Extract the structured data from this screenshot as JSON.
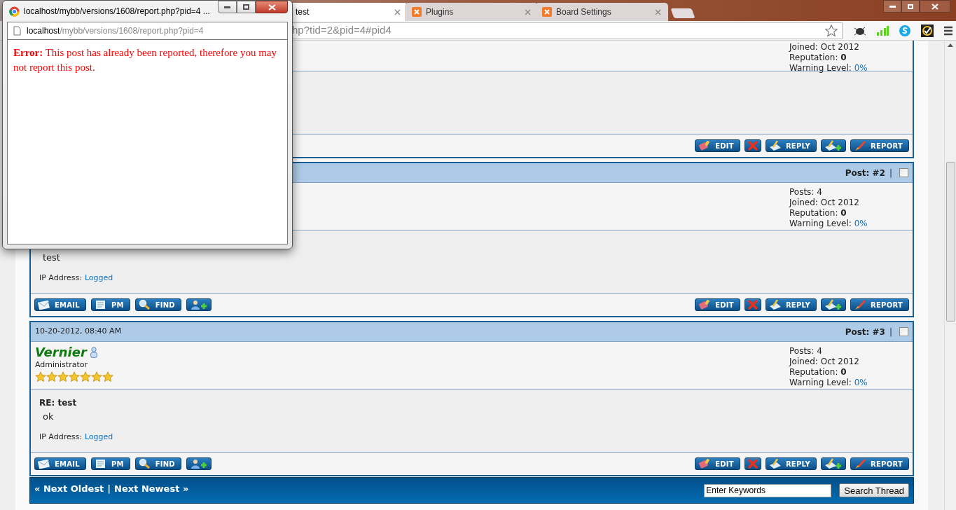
{
  "browser": {
    "tabs": [
      {
        "label": "test",
        "selected": true,
        "favicon": false
      },
      {
        "label": "Plugins",
        "selected": false,
        "favicon": true
      },
      {
        "label": "Board Settings",
        "selected": false,
        "favicon": true
      }
    ],
    "address": "hp?tid=2&pid=4#pid4"
  },
  "posts": [
    {
      "stats": [
        {
          "label": "Joined:",
          "value": "Oct 2012",
          "kind": "plain"
        },
        {
          "label": "Reputation:",
          "value": "0",
          "kind": "bold"
        },
        {
          "label": "Warning Level:",
          "value": "0%",
          "kind": "link"
        }
      ],
      "buttons_right": [
        {
          "kind": "edit",
          "label": "EDIT"
        },
        {
          "kind": "delete"
        },
        {
          "kind": "reply",
          "label": "REPLY"
        },
        {
          "kind": "quote"
        },
        {
          "kind": "report",
          "label": "REPORT"
        }
      ]
    },
    {
      "header": {
        "post_number": "Post: #2",
        "separator": "|",
        "checked": false
      },
      "stats": [
        {
          "label": "Posts:",
          "value": "4",
          "kind": "plain"
        },
        {
          "label": "Joined:",
          "value": "Oct 2012",
          "kind": "plain"
        },
        {
          "label": "Reputation:",
          "value": "0",
          "kind": "bold"
        },
        {
          "label": "Warning Level:",
          "value": "0%",
          "kind": "link"
        }
      ],
      "body": {
        "text": "test",
        "ip_label": "IP Address:",
        "ip_link": "Logged"
      },
      "buttons_left": [
        {
          "kind": "email",
          "label": "EMAIL"
        },
        {
          "kind": "pm",
          "label": "PM"
        },
        {
          "kind": "find",
          "label": "FIND"
        },
        {
          "kind": "adduser"
        }
      ],
      "buttons_right": [
        {
          "kind": "edit",
          "label": "EDIT"
        },
        {
          "kind": "delete"
        },
        {
          "kind": "reply",
          "label": "REPLY"
        },
        {
          "kind": "quote"
        },
        {
          "kind": "report",
          "label": "REPORT"
        }
      ]
    },
    {
      "header": {
        "date": "10-20-2012, 08:40 AM",
        "post_number": "Post: #3",
        "separator": "|",
        "checked": false
      },
      "user": {
        "name": "Vernier",
        "role": "Administrator",
        "stars": 7
      },
      "stats": [
        {
          "label": "Posts:",
          "value": "4",
          "kind": "plain"
        },
        {
          "label": "Joined:",
          "value": "Oct 2012",
          "kind": "plain"
        },
        {
          "label": "Reputation:",
          "value": "0",
          "kind": "bold"
        },
        {
          "label": "Warning Level:",
          "value": "0%",
          "kind": "link"
        }
      ],
      "body": {
        "subject": "RE: test",
        "text": "ok",
        "ip_label": "IP Address:",
        "ip_link": "Logged"
      },
      "buttons_left": [
        {
          "kind": "email",
          "label": "EMAIL"
        },
        {
          "kind": "pm",
          "label": "PM"
        },
        {
          "kind": "find",
          "label": "FIND"
        },
        {
          "kind": "adduser"
        }
      ],
      "buttons_right": [
        {
          "kind": "edit",
          "label": "EDIT"
        },
        {
          "kind": "delete"
        },
        {
          "kind": "reply",
          "label": "REPLY"
        },
        {
          "kind": "quote"
        },
        {
          "kind": "report",
          "label": "REPORT"
        }
      ]
    }
  ],
  "footer": {
    "prev": "« Next Oldest",
    "separator": "|",
    "next": "Next Newest »",
    "search_value": "Enter Keywords",
    "search_button": "Search Thread"
  },
  "popup": {
    "title": "localhost/mybb/versions/1608/report.php?pid=4 ...",
    "address_host": "localhost",
    "address_path": "/mybb/versions/1608/report.php?pid=4",
    "message": "**Error:** This post has already been reported, therefore you may not report this post."
  }
}
